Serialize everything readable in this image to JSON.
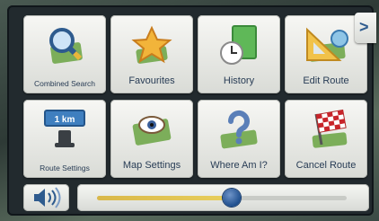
{
  "tiles": [
    {
      "label": "Combined Search",
      "icon": "magnifier-map-icon"
    },
    {
      "label": "Favourites",
      "icon": "star-icon"
    },
    {
      "label": "History",
      "icon": "clock-document-icon"
    },
    {
      "label": "Edit Route",
      "icon": "route-ruler-icon"
    },
    {
      "label": "Route Settings",
      "icon": "route-settings-icon",
      "badge": "1 km"
    },
    {
      "label": "Map Settings",
      "icon": "map-eye-icon"
    },
    {
      "label": "Where Am I?",
      "icon": "question-map-icon"
    },
    {
      "label": "Cancel Route",
      "icon": "checkered-flag-icon"
    }
  ],
  "navigation": {
    "next_icon": ">"
  },
  "volume": {
    "icon": "speaker-icon",
    "level_fraction": 0.54
  },
  "colors": {
    "label": "#283c55",
    "accent": "#2e5b8e",
    "slider_fill": "#e8cf5c"
  }
}
